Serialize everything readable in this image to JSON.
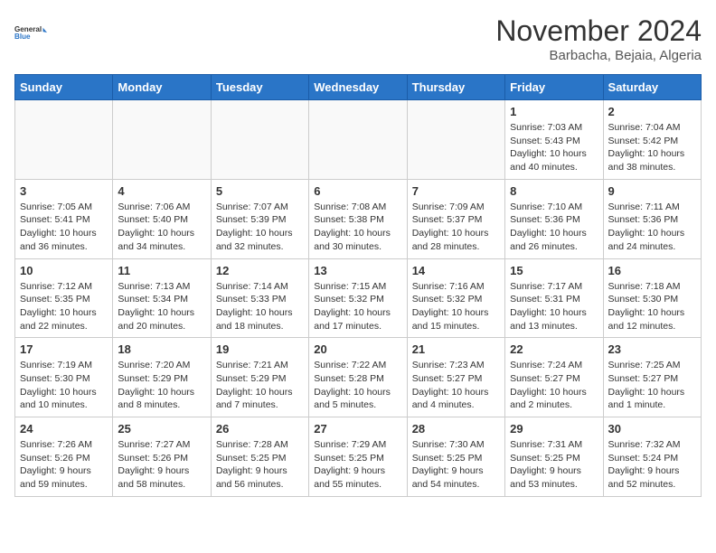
{
  "header": {
    "logo_line1": "General",
    "logo_line2": "Blue",
    "month": "November 2024",
    "location": "Barbacha, Bejaia, Algeria"
  },
  "days_of_week": [
    "Sunday",
    "Monday",
    "Tuesday",
    "Wednesday",
    "Thursday",
    "Friday",
    "Saturday"
  ],
  "weeks": [
    [
      {
        "day": "",
        "info": ""
      },
      {
        "day": "",
        "info": ""
      },
      {
        "day": "",
        "info": ""
      },
      {
        "day": "",
        "info": ""
      },
      {
        "day": "",
        "info": ""
      },
      {
        "day": "1",
        "info": "Sunrise: 7:03 AM\nSunset: 5:43 PM\nDaylight: 10 hours and 40 minutes."
      },
      {
        "day": "2",
        "info": "Sunrise: 7:04 AM\nSunset: 5:42 PM\nDaylight: 10 hours and 38 minutes."
      }
    ],
    [
      {
        "day": "3",
        "info": "Sunrise: 7:05 AM\nSunset: 5:41 PM\nDaylight: 10 hours and 36 minutes."
      },
      {
        "day": "4",
        "info": "Sunrise: 7:06 AM\nSunset: 5:40 PM\nDaylight: 10 hours and 34 minutes."
      },
      {
        "day": "5",
        "info": "Sunrise: 7:07 AM\nSunset: 5:39 PM\nDaylight: 10 hours and 32 minutes."
      },
      {
        "day": "6",
        "info": "Sunrise: 7:08 AM\nSunset: 5:38 PM\nDaylight: 10 hours and 30 minutes."
      },
      {
        "day": "7",
        "info": "Sunrise: 7:09 AM\nSunset: 5:37 PM\nDaylight: 10 hours and 28 minutes."
      },
      {
        "day": "8",
        "info": "Sunrise: 7:10 AM\nSunset: 5:36 PM\nDaylight: 10 hours and 26 minutes."
      },
      {
        "day": "9",
        "info": "Sunrise: 7:11 AM\nSunset: 5:36 PM\nDaylight: 10 hours and 24 minutes."
      }
    ],
    [
      {
        "day": "10",
        "info": "Sunrise: 7:12 AM\nSunset: 5:35 PM\nDaylight: 10 hours and 22 minutes."
      },
      {
        "day": "11",
        "info": "Sunrise: 7:13 AM\nSunset: 5:34 PM\nDaylight: 10 hours and 20 minutes."
      },
      {
        "day": "12",
        "info": "Sunrise: 7:14 AM\nSunset: 5:33 PM\nDaylight: 10 hours and 18 minutes."
      },
      {
        "day": "13",
        "info": "Sunrise: 7:15 AM\nSunset: 5:32 PM\nDaylight: 10 hours and 17 minutes."
      },
      {
        "day": "14",
        "info": "Sunrise: 7:16 AM\nSunset: 5:32 PM\nDaylight: 10 hours and 15 minutes."
      },
      {
        "day": "15",
        "info": "Sunrise: 7:17 AM\nSunset: 5:31 PM\nDaylight: 10 hours and 13 minutes."
      },
      {
        "day": "16",
        "info": "Sunrise: 7:18 AM\nSunset: 5:30 PM\nDaylight: 10 hours and 12 minutes."
      }
    ],
    [
      {
        "day": "17",
        "info": "Sunrise: 7:19 AM\nSunset: 5:30 PM\nDaylight: 10 hours and 10 minutes."
      },
      {
        "day": "18",
        "info": "Sunrise: 7:20 AM\nSunset: 5:29 PM\nDaylight: 10 hours and 8 minutes."
      },
      {
        "day": "19",
        "info": "Sunrise: 7:21 AM\nSunset: 5:29 PM\nDaylight: 10 hours and 7 minutes."
      },
      {
        "day": "20",
        "info": "Sunrise: 7:22 AM\nSunset: 5:28 PM\nDaylight: 10 hours and 5 minutes."
      },
      {
        "day": "21",
        "info": "Sunrise: 7:23 AM\nSunset: 5:27 PM\nDaylight: 10 hours and 4 minutes."
      },
      {
        "day": "22",
        "info": "Sunrise: 7:24 AM\nSunset: 5:27 PM\nDaylight: 10 hours and 2 minutes."
      },
      {
        "day": "23",
        "info": "Sunrise: 7:25 AM\nSunset: 5:27 PM\nDaylight: 10 hours and 1 minute."
      }
    ],
    [
      {
        "day": "24",
        "info": "Sunrise: 7:26 AM\nSunset: 5:26 PM\nDaylight: 9 hours and 59 minutes."
      },
      {
        "day": "25",
        "info": "Sunrise: 7:27 AM\nSunset: 5:26 PM\nDaylight: 9 hours and 58 minutes."
      },
      {
        "day": "26",
        "info": "Sunrise: 7:28 AM\nSunset: 5:25 PM\nDaylight: 9 hours and 56 minutes."
      },
      {
        "day": "27",
        "info": "Sunrise: 7:29 AM\nSunset: 5:25 PM\nDaylight: 9 hours and 55 minutes."
      },
      {
        "day": "28",
        "info": "Sunrise: 7:30 AM\nSunset: 5:25 PM\nDaylight: 9 hours and 54 minutes."
      },
      {
        "day": "29",
        "info": "Sunrise: 7:31 AM\nSunset: 5:25 PM\nDaylight: 9 hours and 53 minutes."
      },
      {
        "day": "30",
        "info": "Sunrise: 7:32 AM\nSunset: 5:24 PM\nDaylight: 9 hours and 52 minutes."
      }
    ]
  ]
}
